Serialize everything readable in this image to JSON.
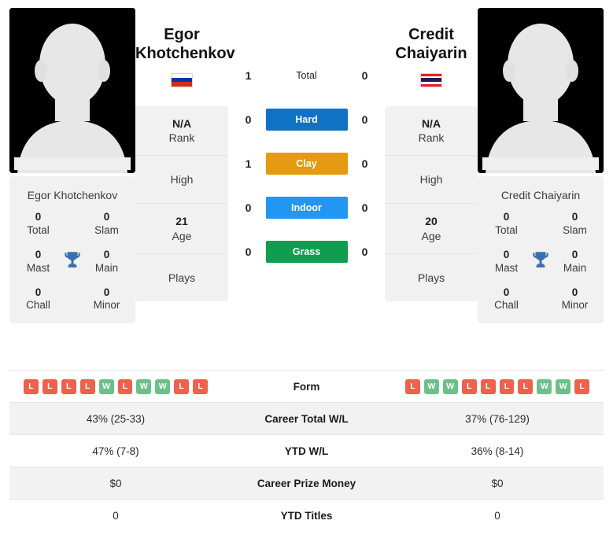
{
  "players": {
    "left": {
      "name_line1": "Egor",
      "name_line2": "Khotchenkov",
      "full_name": "Egor Khotchenkov",
      "country": "Russia",
      "flag_colors": [
        "#ffffff",
        "#0039a6",
        "#d52b1e"
      ],
      "rank": "N/A",
      "rank_label": "Rank",
      "high_label": "High",
      "high_value": "",
      "age": "21",
      "age_label": "Age",
      "plays_label": "Plays",
      "plays_value": "",
      "titles": [
        {
          "num": "0",
          "label": "Total"
        },
        {
          "num": "0",
          "label": "Slam"
        },
        {
          "num": "0",
          "label": "Mast"
        },
        {
          "num": "0",
          "label": "Main"
        },
        {
          "num": "0",
          "label": "Chall"
        },
        {
          "num": "0",
          "label": "Minor"
        }
      ],
      "form": [
        "L",
        "L",
        "L",
        "L",
        "W",
        "L",
        "W",
        "W",
        "L",
        "L"
      ],
      "career_total_wl": "43% (25-33)",
      "ytd_wl": "47% (7-8)",
      "career_prize_money": "$0",
      "ytd_titles": "0"
    },
    "right": {
      "name_line1": "Credit",
      "name_line2": "Chaiyarin",
      "full_name": "Credit Chaiyarin",
      "country": "Thailand",
      "flag_colors": [
        "#ed1c24",
        "#ffffff",
        "#241d4f",
        "#ffffff",
        "#ed1c24"
      ],
      "rank": "N/A",
      "rank_label": "Rank",
      "high_label": "High",
      "high_value": "",
      "age": "20",
      "age_label": "Age",
      "plays_label": "Plays",
      "plays_value": "",
      "titles": [
        {
          "num": "0",
          "label": "Total"
        },
        {
          "num": "0",
          "label": "Slam"
        },
        {
          "num": "0",
          "label": "Mast"
        },
        {
          "num": "0",
          "label": "Main"
        },
        {
          "num": "0",
          "label": "Chall"
        },
        {
          "num": "0",
          "label": "Minor"
        }
      ],
      "form": [
        "L",
        "W",
        "W",
        "L",
        "L",
        "L",
        "L",
        "W",
        "W",
        "L"
      ],
      "career_total_wl": "37% (76-129)",
      "ytd_wl": "36% (8-14)",
      "career_prize_money": "$0",
      "ytd_titles": "0"
    }
  },
  "head_to_head": [
    {
      "label": "Total",
      "left": "1",
      "right": "0",
      "badge": false,
      "color": ""
    },
    {
      "label": "Hard",
      "left": "0",
      "right": "0",
      "badge": true,
      "color": "#0f72c4"
    },
    {
      "label": "Clay",
      "left": "1",
      "right": "0",
      "badge": true,
      "color": "#e49b0f"
    },
    {
      "label": "Indoor",
      "left": "0",
      "right": "0",
      "badge": true,
      "color": "#2196f3"
    },
    {
      "label": "Grass",
      "left": "0",
      "right": "0",
      "badge": true,
      "color": "#0f9d4f"
    }
  ],
  "stats_rows": [
    {
      "label": "Form",
      "key": "form",
      "type": "form"
    },
    {
      "label": "Career Total W/L",
      "key": "career_total_wl",
      "type": "text"
    },
    {
      "label": "YTD W/L",
      "key": "ytd_wl",
      "type": "text"
    },
    {
      "label": "Career Prize Money",
      "key": "career_prize_money",
      "type": "text"
    },
    {
      "label": "YTD Titles",
      "key": "ytd_titles",
      "type": "text"
    }
  ],
  "colors": {
    "win_badge": "#6ec08a",
    "loss_badge": "#ef604d",
    "trophy": "#3a6fb0",
    "card_bg": "#f1f1f1",
    "row_shade": "#f2f2f2"
  },
  "icons": {
    "trophy": "trophy-icon",
    "avatar": "avatar-placeholder-icon"
  }
}
